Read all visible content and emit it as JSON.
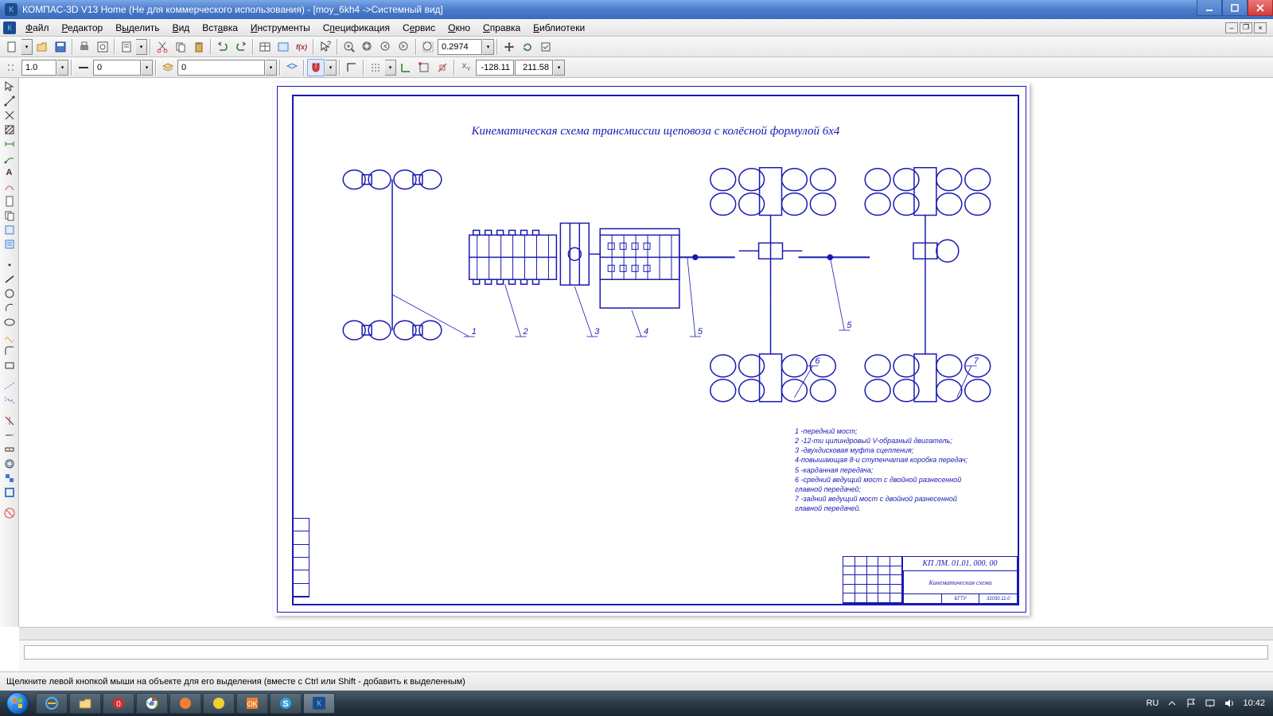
{
  "titlebar": {
    "title": "КОМПАС-3D V13 Home (Не для коммерческого использования) - [moy_6kh4 ->Системный вид]"
  },
  "menu": {
    "file": "Файл",
    "edit": "Редактор",
    "select": "Выделить",
    "view": "Вид",
    "insert": "Вставка",
    "tools": "Инструменты",
    "spec": "Спецификация",
    "service": "Сервис",
    "window": "Окно",
    "help": "Справка",
    "libs": "Библиотеки"
  },
  "toolbar1": {
    "zoom_value": "0.2974"
  },
  "toolbar2": {
    "lineweight": "1.0",
    "style": "0",
    "layer": "0",
    "coord_x": "-128.11",
    "coord_y": "211.58"
  },
  "drawing": {
    "title": "Кинематическая схема трансмиссии щеповоза с колёсной формулой 6х4",
    "legend1": "1 -передний мост;",
    "legend2": "2 -12-ти цилиндровый V-образный двигатель;",
    "legend3": "3 -двухдисковая муфта сцепления;",
    "legend4": "4-повышающая 8-и ступенчатая коробка передач;",
    "legend5": "5 -карданная передача;",
    "legend6": "6 -средний ведущий мост с двойной разнесенной главной передачей;",
    "legend7": "7 -задний ведущий мост с двойной разнесенной главной передачей.",
    "doc_number": "КП ЛМ. 01.01. 000. 00",
    "doc_name": "Кинематическая схема",
    "group": "31030.11.0",
    "lit": "БГТУ",
    "callout1": "1",
    "callout2": "2",
    "callout3": "3",
    "callout4": "4",
    "callout5": "5",
    "callout55": "5",
    "callout6": "6",
    "callout7": "7"
  },
  "status": {
    "hint": "Щелкните левой кнопкой мыши на объекте для его выделения (вместе с Ctrl или Shift - добавить к выделенным)"
  },
  "taskbar": {
    "lang": "RU",
    "time": "10:42"
  }
}
